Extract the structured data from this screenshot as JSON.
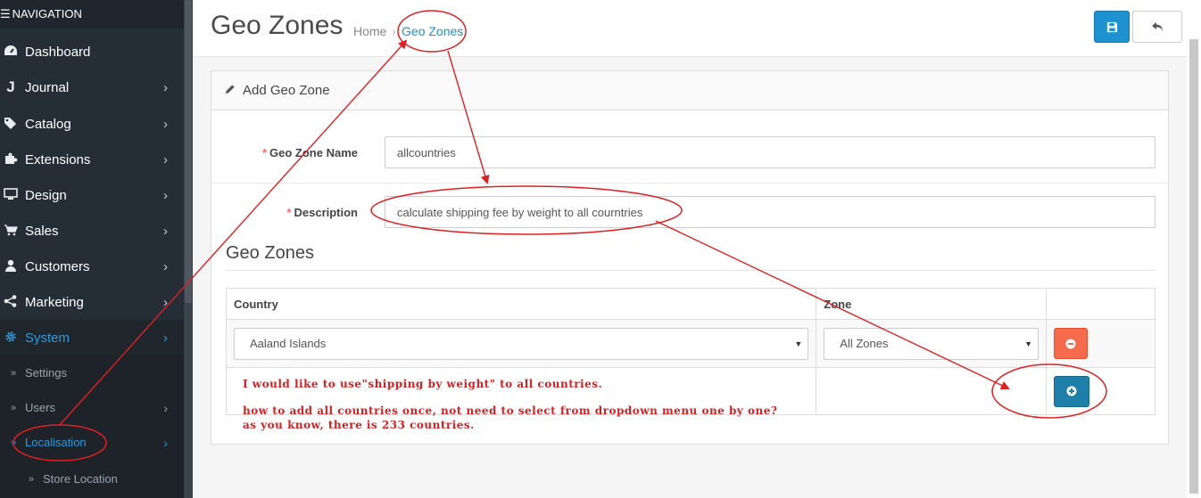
{
  "sidebar": {
    "header": "NAVIGATION",
    "items": [
      {
        "label": "Dashboard",
        "icon": "dashboard-icon",
        "has_arrow": false
      },
      {
        "label": "Journal",
        "icon": "journal-icon",
        "has_arrow": true
      },
      {
        "label": "Catalog",
        "icon": "tags-icon",
        "has_arrow": true
      },
      {
        "label": "Extensions",
        "icon": "puzzle-icon",
        "has_arrow": true
      },
      {
        "label": "Design",
        "icon": "monitor-icon",
        "has_arrow": true
      },
      {
        "label": "Sales",
        "icon": "cart-icon",
        "has_arrow": true
      },
      {
        "label": "Customers",
        "icon": "user-icon",
        "has_arrow": true
      },
      {
        "label": "Marketing",
        "icon": "share-icon",
        "has_arrow": true
      },
      {
        "label": "System",
        "icon": "gear-icon",
        "has_arrow": true,
        "active": true
      }
    ],
    "subitems": [
      {
        "label": "Settings",
        "has_arrow": false
      },
      {
        "label": "Users",
        "has_arrow": true
      },
      {
        "label": "Localisation",
        "has_arrow": true,
        "active": true
      },
      {
        "label": "Store Location",
        "has_arrow": false
      }
    ]
  },
  "header": {
    "title": "Geo Zones",
    "breadcrumb_home": "Home",
    "breadcrumb_sep": "›",
    "breadcrumb_current": "Geo Zones"
  },
  "panel": {
    "title": "Add Geo Zone",
    "name_label": "Geo Zone Name",
    "name_value": "allcountries",
    "description_label": "Description",
    "description_value": "calculate shipping fee by weight to all courntries",
    "required_mark": "*"
  },
  "zones": {
    "title": "Geo Zones",
    "columns": [
      "Country",
      "Zone"
    ],
    "rows": [
      {
        "country": "Aaland Islands",
        "zone": "All Zones"
      }
    ]
  },
  "annotations": {
    "line1": "I would like to use\"shipping by weight\" to all countries.",
    "line2": "how to add all countries once, not need to select from dropdown menu one by one?",
    "line3": "as you know, there is 233 countries."
  },
  "colors": {
    "sidebar_bg": "#252e36",
    "accent_blue": "#1e91cf",
    "danger": "#f56b4b",
    "annotation_red": "#d42020"
  }
}
